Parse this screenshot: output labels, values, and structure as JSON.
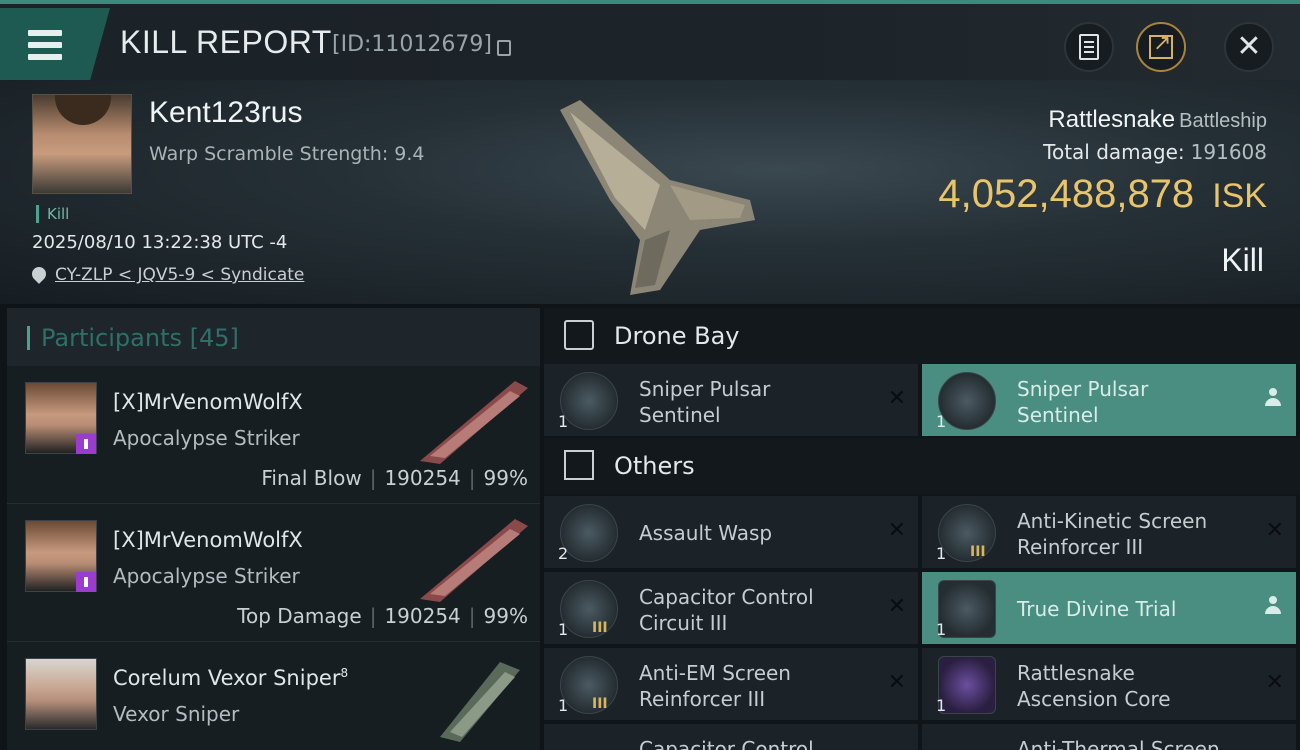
{
  "header": {
    "title": "KILL REPORT",
    "report_id": "[ID:11012679]"
  },
  "victim": {
    "name": "Kent123rus",
    "warp_scramble": "Warp Scramble Strength: 9.4",
    "tag": "Kill",
    "datetime": "2025/08/10 13:22:38 UTC -4",
    "location": "CY-ZLP < JQV5-9 < Syndicate",
    "ship_name": "Rattlesnake",
    "ship_class": "Battleship",
    "total_damage_label": "Total damage:",
    "total_damage": "191608",
    "isk_value": "4,052,488,878",
    "isk_unit": "ISK",
    "result": "Kill"
  },
  "participants": {
    "label": "Participants",
    "count": "[45]",
    "rows": [
      {
        "name": "[X]MrVenomWolfX",
        "ship": "Apocalypse Striker",
        "role": "Final Blow",
        "damage": "190254",
        "percent": "99%"
      },
      {
        "name": "[X]MrVenomWolfX",
        "ship": "Apocalypse Striker",
        "role": "Top Damage",
        "damage": "190254",
        "percent": "99%"
      },
      {
        "name": "Corelum Vexor Sniper",
        "name_sup": "8",
        "ship": "Vexor Sniper"
      }
    ]
  },
  "drone_bay": {
    "label": "Drone Bay",
    "items": [
      {
        "qty": "1",
        "name_l1": "Sniper Pulsar",
        "name_l2": "Sentinel"
      },
      {
        "qty": "1",
        "name_l1": "Sniper Pulsar",
        "name_l2": "Sentinel"
      }
    ]
  },
  "others": {
    "label": "Others",
    "items": [
      {
        "qty": "2",
        "name": "Assault Wasp"
      },
      {
        "qty": "1",
        "meta": "III",
        "name_l1": "Anti-Kinetic Screen",
        "name_l2": "Reinforcer III"
      },
      {
        "qty": "1",
        "meta": "III",
        "name_l1": "Capacitor Control",
        "name_l2": "Circuit III"
      },
      {
        "qty": "1",
        "name": "True Divine Trial"
      },
      {
        "qty": "1",
        "meta": "III",
        "name_l1": "Anti-EM Screen",
        "name_l2": "Reinforcer III"
      },
      {
        "qty": "1",
        "name_l1": "Rattlesnake",
        "name_l2": "Ascension Core"
      },
      {
        "name": "Capacitor Control"
      },
      {
        "name": "Anti-Thermal Screen"
      }
    ]
  },
  "colors": {
    "accent": "#4a8e82",
    "isk": "#e8c46a"
  }
}
